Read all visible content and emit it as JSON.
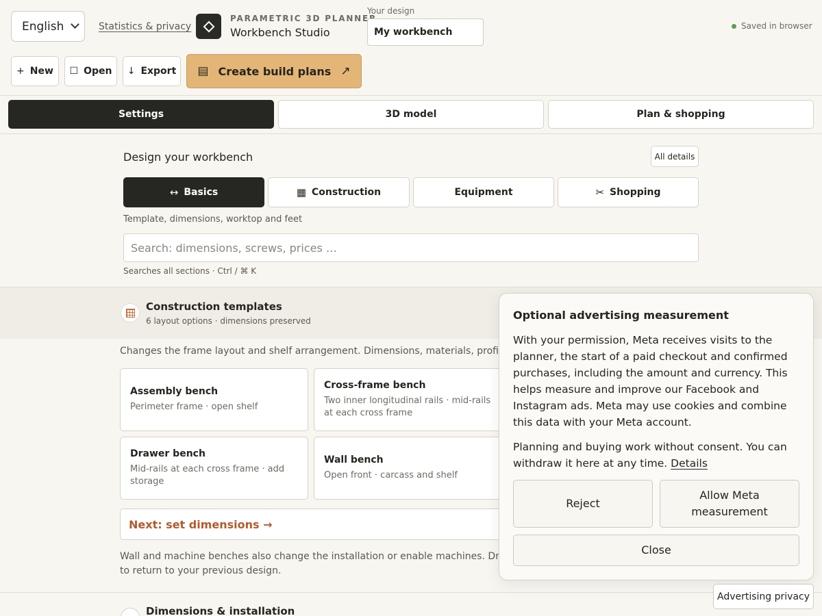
{
  "header": {
    "language": "English",
    "stats_link": "Statistics & privacy",
    "brand_top": "PARAMETRIC 3D PLANNER",
    "brand_name": "Workbench Studio",
    "design_label": "Your design",
    "design_value": "My workbench",
    "saved_status": "Saved in browser"
  },
  "toolbar": {
    "new_icon": "+",
    "new_label": "New",
    "open_icon": "☐",
    "open_label": "Open",
    "export_icon": "↓",
    "export_label": "Export",
    "create_icon": "▤",
    "create_label": "Create build plans",
    "create_arrow": "↗"
  },
  "main_tabs": [
    {
      "label": "Settings",
      "active": true
    },
    {
      "label": "3D model",
      "active": false
    },
    {
      "label": "Plan & shopping",
      "active": false
    }
  ],
  "settings": {
    "title": "Design your workbench",
    "all_details": "All details",
    "tabs": [
      {
        "icon": "↔",
        "label": "Basics",
        "active": true
      },
      {
        "icon": "▦",
        "label": "Construction",
        "active": false
      },
      {
        "icon": "",
        "label": "Equipment",
        "active": false
      },
      {
        "icon": "✂",
        "label": "Shopping",
        "active": false
      }
    ],
    "hint": "Template, dimensions, worktop and feet",
    "search_placeholder": "Search: dimensions, screws, prices …",
    "search_hint": "Searches all sections · Ctrl / ⌘ K"
  },
  "templates": {
    "title": "Construction templates",
    "subtitle": "6 layout options · dimensions preserved",
    "description": "Changes the frame layout and shelf arrangement. Dimensions, materials, profiles, jo",
    "cards": [
      {
        "title": "Assembly bench",
        "sub": "Perimeter frame · open shelf"
      },
      {
        "title": "Cross-frame bench",
        "sub": "Two inner longitudinal rails · mid-rails at each cross frame"
      },
      {
        "title": "Drawer bench",
        "sub": "Mid-rails at each cross frame · add storage"
      },
      {
        "title": "Wall bench",
        "sub": "Open front · carcass and shelf"
      }
    ],
    "next": "Next: set dimensions →",
    "footnote_1": "Wall and machine benches also change the installation or enable machines. Drawers",
    "footnote_2": "to return to your previous design."
  },
  "dimensions": {
    "title": "Dimensions & installation"
  },
  "consent": {
    "title": "Optional advertising measurement",
    "p1": "With your permission, Meta receives visits to the planner, the start of a paid checkout and confirmed purchases, including the amount and currency. This helps measure and improve our Facebook and Instagram ads. Meta may use cookies and combine this data with your Meta account.",
    "p2": "Planning and buying work without consent. You can withdraw it here at any time.",
    "details": "Details",
    "reject": "Reject",
    "allow": "Allow Meta measurement",
    "close": "Close",
    "ad_privacy": "Advertising privacy"
  },
  "colors": {
    "accent": "#e3b576",
    "dark": "#262622",
    "link_orange": "#b45a2c",
    "saved_dot": "#5e9a5c"
  }
}
